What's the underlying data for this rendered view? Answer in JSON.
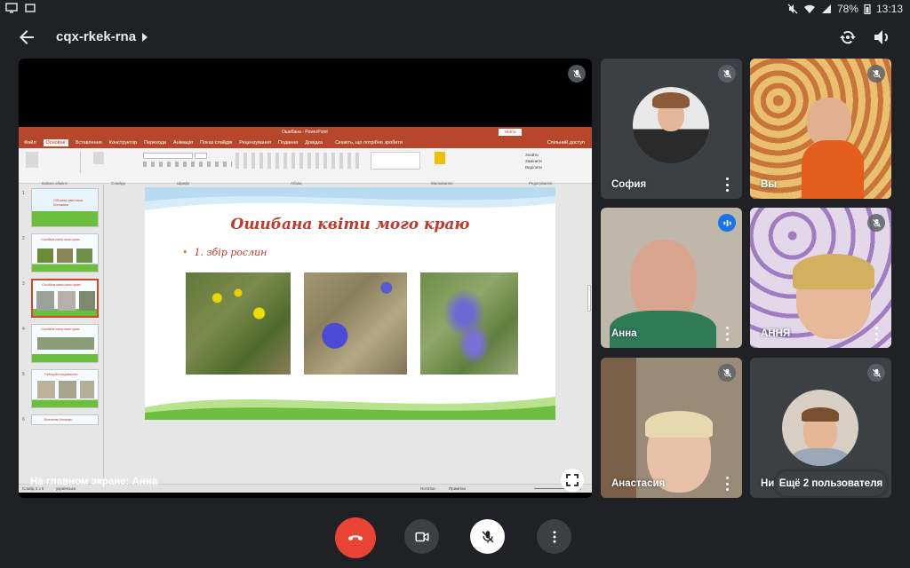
{
  "status_bar": {
    "battery": "78%",
    "time": "13:13"
  },
  "meeting": {
    "code": "cqx-rkek-rna"
  },
  "presentation": {
    "caption": "На главном экране: Анна",
    "app_title": "Ошибана - PowerPoint",
    "ribbon_tabs": [
      "Файл",
      "Основне",
      "Вставлення",
      "Конструктор",
      "Переходи",
      "Анімація",
      "Показ слайдів",
      "Рецензування",
      "Подання",
      "Довідка"
    ],
    "tell_me": "Скажіть, що потрібно зробити",
    "share": "Спільний доступ",
    "ribbon_groups": [
      "Буфер обміну",
      "Слайди",
      "Шрифт",
      "Абзац",
      "Малювання",
      "Редагування"
    ],
    "slide_title": "Ошибана квіти могo краю",
    "slide_bullet": "1. збір рослин",
    "thumb_titles": [
      "Обшана квітника ботаніки",
      "Ошибана квіти мого краю",
      "Ошибана квіти мого краю",
      "Ошибана квіти мого краю",
      "Радіаційні покраюкінно",
      "Вивчення ботаніки"
    ],
    "thumb_numbers": [
      "1",
      "2",
      "3",
      "4",
      "5",
      "6"
    ],
    "status_left": "Слайд 3 з 6",
    "status_lang": "українська",
    "status_notes": "Нотатки",
    "status_comments": "Примітки",
    "zoom": "36%"
  },
  "participants": [
    {
      "name": "София",
      "muted": true
    },
    {
      "name": "Вы",
      "muted": true
    },
    {
      "name": "Анна",
      "muted": false,
      "speaking": true
    },
    {
      "name": "АННЯ",
      "muted": true
    },
    {
      "name": "Анастасия",
      "muted": true
    },
    {
      "name": "Ни",
      "muted": true
    }
  ],
  "more_users_label": "Ещё 2 пользователя",
  "colors": {
    "background": "#202124",
    "tile": "#3c4043",
    "hangup": "#ea4335",
    "speaking": "#1a73e8",
    "ppt_accent": "#b7472a"
  }
}
